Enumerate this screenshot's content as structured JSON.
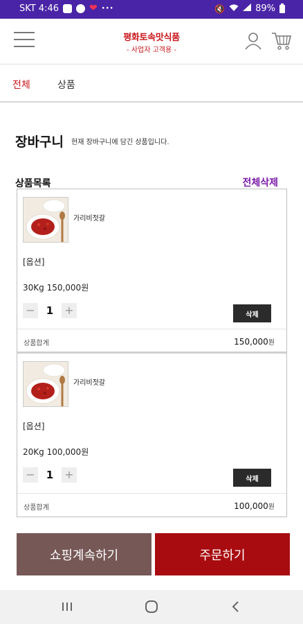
{
  "status_bar": {
    "time": "SKT 4:46",
    "battery": "89%"
  },
  "header": {
    "store_name": "평화토속맛식품",
    "store_subtitle": "- 사업자 고객용 -"
  },
  "tabs": [
    {
      "label": "전체",
      "active": true
    },
    {
      "label": "상품",
      "active": false
    }
  ],
  "page": {
    "title": "장바구니",
    "description": "현재 장바구니에 담긴 상품입니다."
  },
  "cart": {
    "list_title": "상품목록",
    "delete_all_label": "전체삭제",
    "items": [
      {
        "name": "가리비젓갈",
        "option_label": "[옵션]",
        "option_detail": "30Kg  150,000원",
        "quantity": "1",
        "delete_label": "삭제",
        "subtotal_label": "상품합계",
        "subtotal_value": "150,000",
        "currency": "원"
      },
      {
        "name": "가리비젓갈",
        "option_label": "[옵션]",
        "option_detail": "20Kg  100,000원",
        "quantity": "1",
        "delete_label": "삭제",
        "subtotal_label": "상품합계",
        "subtotal_value": "100,000",
        "currency": "원"
      }
    ]
  },
  "actions": {
    "continue_label": "쇼핑계속하기",
    "order_label": "주문하기"
  },
  "colors": {
    "status_bar": "#4a24a6",
    "brand_red": "#c9161b",
    "delete_all": "#7a1aa8",
    "continue_button": "#765856",
    "order_button": "#a80c10"
  }
}
